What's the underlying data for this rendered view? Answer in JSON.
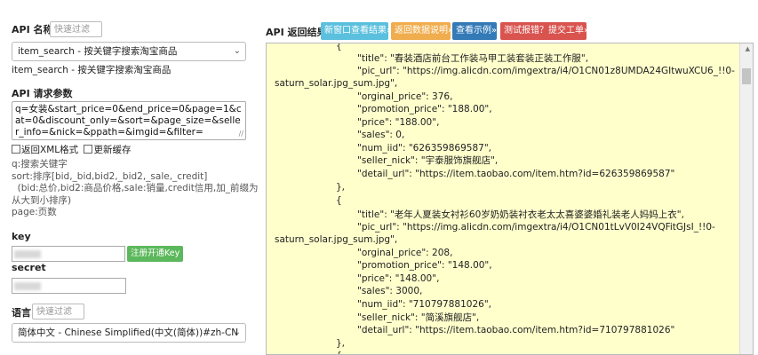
{
  "left": {
    "api_name_label": "API 名称",
    "api_filter_placeholder": "快速过滤",
    "api_select_value": "item_search - 按关键字搜索淘宝商品",
    "api_selected_desc": "item_search - 按关键字搜索淘宝商品",
    "params_label": "API 请求参数",
    "params_value": "q=女装&start_price=0&end_price=0&page=1&cat=0&discount_only=&sort=&page_size=&seller_info=&nick=&ppath=&imgid=&filter=",
    "xml_checkbox_label": "返回XML格式",
    "refresh_cache_label": "更新缓存",
    "help_lines": [
      "q:搜索关键字",
      "sort:排序[bid,_bid,bid2,_bid2,_sale,_credit]",
      "  (bid:总价,bid2:商品价格,sale:销量,credit信用,加_前缀为",
      "从大到小排序)",
      "page:页数"
    ],
    "key_label": "key",
    "register_button": "注册开通Key",
    "secret_label": "secret",
    "lang_label": "语言",
    "lang_filter_placeholder": "快速过滤",
    "lang_select_value": "简体中文 - Chinese Simplified(中文(简体))#zh-CN"
  },
  "right": {
    "result_label": "API 返回结果",
    "buttons": [
      {
        "label": "新窗口查看结果»",
        "color": "#5bc0de"
      },
      {
        "label": "返回数据说明»",
        "color": "#f0ad4e"
      },
      {
        "label": "查看示例»",
        "color": "#337ab7"
      },
      {
        "label": "测试报错？提交工单»",
        "color": "#d9534f"
      }
    ],
    "json_lines": [
      "{",
      "\"title\": \"春装酒店前台工作装马甲工装套装正装工作服\",",
      "\"pic_url\": \"https://img.alicdn.com/imgextra/i4/O1CN01z8UMDA24GItwuXCU6_!!0-",
      "saturn_solar.jpg_sum.jpg\",",
      "\"orginal_price\": 376,",
      "\"promotion_price\": \"188.00\",",
      "\"price\": \"188.00\",",
      "\"sales\": 0,",
      "\"num_iid\": \"626359869587\",",
      "\"seller_nick\": \"宇泰服饰旗舰店\",",
      "\"detail_url\": \"https://item.taobao.com/item.htm?id=626359869587\"",
      "},",
      "{",
      "\"title\": \"老年人夏装女衬衫60岁奶奶装衬衣老太太喜婆婆婚礼装老人妈妈上衣\",",
      "\"pic_url\": \"https://img.alicdn.com/imgextra/i4/O1CN01tLvV0I24VQFitGJsI_!!0-",
      "saturn_solar.jpg_sum.jpg\",",
      "\"orginal_price\": 208,",
      "\"promotion_price\": \"148.00\",",
      "\"price\": \"148.00\",",
      "\"sales\": 3000,",
      "\"num_iid\": \"710797881026\",",
      "\"seller_nick\": \"简溪旗舰店\",",
      "\"detail_url\": \"https://item.taobao.com/item.htm?id=710797881026\"",
      "},",
      "{"
    ]
  }
}
